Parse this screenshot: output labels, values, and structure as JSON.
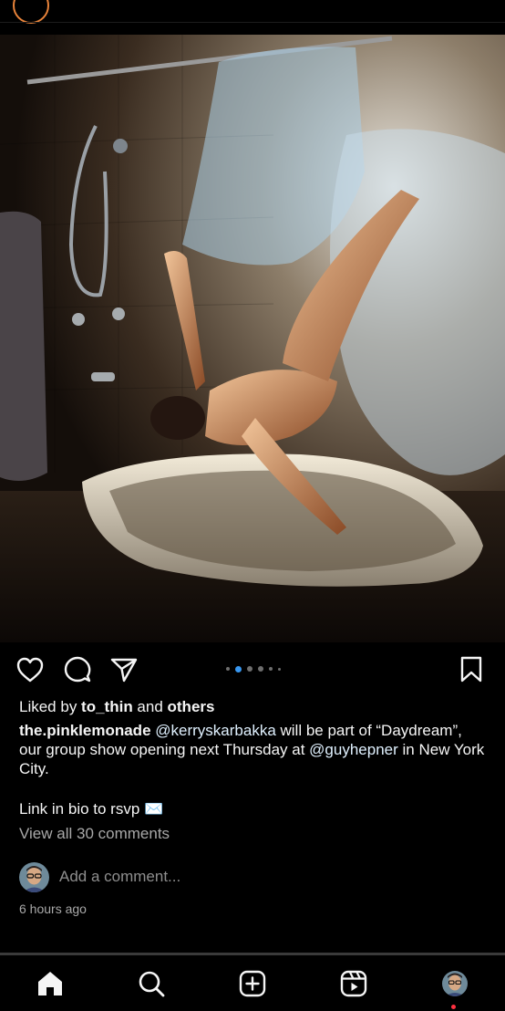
{
  "post": {
    "image_alt": "Photo of a person falling backwards into a bathtub, grabbing a clear shower curtain",
    "carousel": {
      "count": 5,
      "active_index": 1
    },
    "likes": {
      "prefix": "Liked by ",
      "user": "to_thin",
      "connector": " and ",
      "others": "others"
    },
    "caption": {
      "author": "the.pinklemonade",
      "mention_1": "@kerryskarbakka",
      "text_1": " will be part of “Daydream”, our group show opening next Thursday at ",
      "mention_2": "@guyhepner",
      "text_2": " in New York City.",
      "rsvp_line": "Link in bio to rsvp ✉️"
    },
    "view_comments": "View all 30 comments",
    "comment_placeholder": "Add a comment...",
    "timestamp": "6 hours ago"
  },
  "icons": {
    "like": "heart-icon",
    "comment": "comment-icon",
    "share": "paper-plane-icon",
    "save": "bookmark-icon"
  },
  "tabs": [
    {
      "name": "home",
      "icon": "home-icon",
      "active": true
    },
    {
      "name": "search",
      "icon": "search-icon"
    },
    {
      "name": "create",
      "icon": "plus-square-icon"
    },
    {
      "name": "reels",
      "icon": "reels-icon"
    },
    {
      "name": "profile",
      "icon": "profile-avatar",
      "has_notification": true
    }
  ],
  "colors": {
    "background": "#000000",
    "text": "#f5f5f5",
    "secondary_text": "#a8a8a8",
    "carousel_active": "#3897f0",
    "notification": "#ff3040"
  }
}
